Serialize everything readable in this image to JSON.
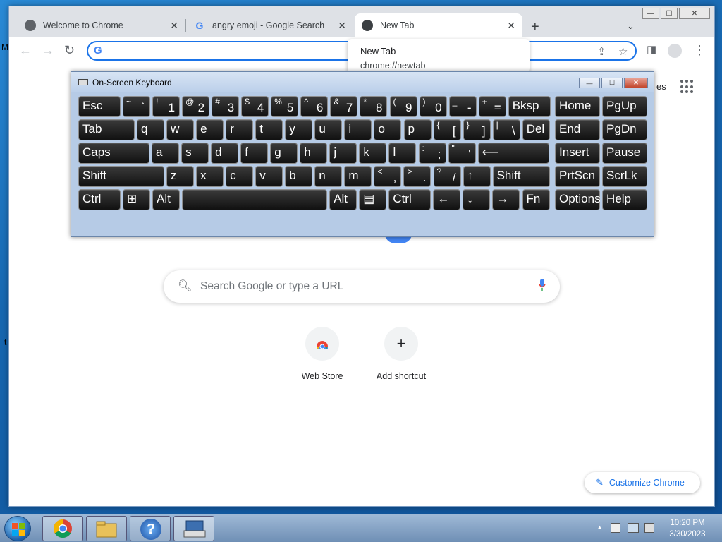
{
  "desktop": {
    "frag_left_top": "M",
    "frag_left_mid": "t"
  },
  "chrome": {
    "tabs": [
      {
        "title": "Welcome to Chrome",
        "favicon": "globe-icon"
      },
      {
        "title": "angry emoji - Google Search",
        "favicon": "google-icon"
      },
      {
        "title": "New Tab",
        "favicon": "chrome-icon"
      }
    ],
    "tab_close_glyph": "✕",
    "new_tab_glyph": "+",
    "tab_menu_glyph": "⌄",
    "window_buttons": {
      "min": "—",
      "max": "☐",
      "close": "✕"
    },
    "toolbar": {
      "back": "←",
      "forward": "→",
      "reload": "↻",
      "omnibox_value": ""
    },
    "hover_card": {
      "title": "New Tab",
      "url": "chrome://newtab"
    },
    "ntp": {
      "partial_label": "es",
      "search_placeholder": "Search Google or type a URL",
      "shortcuts": [
        {
          "label": "Web Store",
          "icon": "webstore-icon"
        },
        {
          "label": "Add shortcut",
          "icon": "plus-icon",
          "glyph": "+"
        }
      ],
      "customize_label": "Customize Chrome"
    }
  },
  "osk": {
    "title": "On-Screen Keyboard",
    "rows": [
      [
        {
          "main": "Esc"
        },
        {
          "big": "`",
          "sm": "~"
        },
        {
          "big": "1",
          "sm": "!"
        },
        {
          "big": "2",
          "sm": "@"
        },
        {
          "big": "3",
          "sm": "#"
        },
        {
          "big": "4",
          "sm": "$"
        },
        {
          "big": "5",
          "sm": "%"
        },
        {
          "big": "6",
          "sm": "^"
        },
        {
          "big": "7",
          "sm": "&"
        },
        {
          "big": "8",
          "sm": "*"
        },
        {
          "big": "9",
          "sm": "("
        },
        {
          "big": "0",
          "sm": ")"
        },
        {
          "big": "-",
          "sm": "_"
        },
        {
          "big": "=",
          "sm": "+"
        },
        {
          "main": "Bksp"
        },
        {
          "main": "Home"
        },
        {
          "main": "PgUp"
        }
      ],
      [
        {
          "main": "Tab"
        },
        {
          "main": "q"
        },
        {
          "main": "w"
        },
        {
          "main": "e"
        },
        {
          "main": "r"
        },
        {
          "main": "t"
        },
        {
          "main": "y"
        },
        {
          "main": "u"
        },
        {
          "main": "i"
        },
        {
          "main": "o"
        },
        {
          "main": "p"
        },
        {
          "big": "[",
          "sm": "{"
        },
        {
          "big": "]",
          "sm": "}"
        },
        {
          "big": "\\",
          "sm": "|"
        },
        {
          "main": "Del"
        },
        {
          "main": "End"
        },
        {
          "main": "PgDn"
        }
      ],
      [
        {
          "main": "Caps"
        },
        {
          "main": "a"
        },
        {
          "main": "s"
        },
        {
          "main": "d"
        },
        {
          "main": "f"
        },
        {
          "main": "g"
        },
        {
          "main": "h"
        },
        {
          "main": "j"
        },
        {
          "main": "k"
        },
        {
          "main": "l"
        },
        {
          "big": ";",
          "sm": ":"
        },
        {
          "big": "'",
          "sm": "\""
        },
        {
          "main": "⟵"
        },
        {
          "main": "Insert"
        },
        {
          "main": "Pause"
        }
      ],
      [
        {
          "main": "Shift"
        },
        {
          "main": "z"
        },
        {
          "main": "x"
        },
        {
          "main": "c"
        },
        {
          "main": "v"
        },
        {
          "main": "b"
        },
        {
          "main": "n"
        },
        {
          "main": "m"
        },
        {
          "big": ",",
          "sm": "<"
        },
        {
          "big": ".",
          "sm": ">"
        },
        {
          "big": "/",
          "sm": "?"
        },
        {
          "main": "↑"
        },
        {
          "main": "Shift"
        },
        {
          "main": "PrtScn"
        },
        {
          "main": "ScrLk"
        }
      ],
      [
        {
          "main": "Ctrl"
        },
        {
          "main": "⊞"
        },
        {
          "main": "Alt"
        },
        {
          "main": ""
        },
        {
          "main": "Alt"
        },
        {
          "main": "▤"
        },
        {
          "main": "Ctrl"
        },
        {
          "main": "←"
        },
        {
          "main": "↓"
        },
        {
          "main": "→"
        },
        {
          "main": "Fn"
        },
        {
          "main": "Options"
        },
        {
          "main": "Help"
        }
      ]
    ]
  },
  "taskbar": {
    "start": "start-orb",
    "apps": [
      "chrome-icon",
      "explorer-icon",
      "help-icon",
      "osk-icon"
    ],
    "tray_arrow": "▲",
    "time": "10:20 PM",
    "date": "3/30/2023"
  }
}
